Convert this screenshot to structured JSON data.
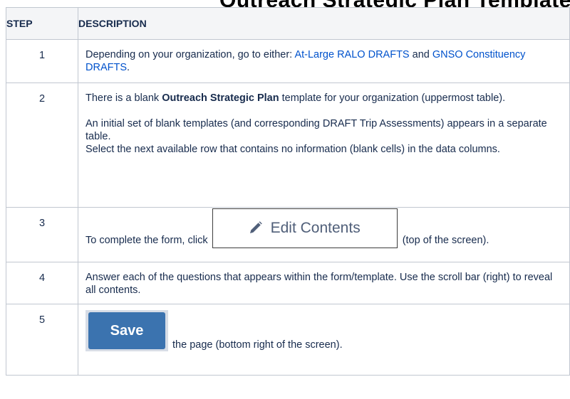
{
  "page": {
    "title_fragment": "   Outreach Strategic Plan Template"
  },
  "table": {
    "header": {
      "step": "STEP",
      "description": "DESCRIPTION"
    },
    "rows": [
      {
        "step": "1",
        "text_before": "Depending on your organization, go to either: ",
        "link1": "At-Large RALO DRAFTS",
        "text_mid": " and ",
        "link2": "GNSO Constituency DRAFTS",
        "text_after": "."
      },
      {
        "step": "2",
        "p1_before": "There is a blank ",
        "p1_bold": "Outreach Strategic Plan",
        "p1_after": " template for your organization (uppermost table).",
        "p2": "An initial set of blank templates (and corresponding DRAFT Trip Assessments) appears in a separate table.",
        "p3": "Select the next available row that contains no information (blank cells) in the data columns."
      },
      {
        "step": "3",
        "text_before": "To complete the form, click ",
        "button_label": "Edit Contents",
        "button_icon": "pencil-icon",
        "text_after": " (top of the screen)."
      },
      {
        "step": "4",
        "text": "Answer each of the questions that appears within the form/template. Use the scroll bar (right) to reveal all contents."
      },
      {
        "step": "5",
        "button_label": "Save",
        "text_after": " the page (bottom right of the screen)."
      }
    ]
  },
  "colors": {
    "link": "#0052cc",
    "save_button": "#3b73af",
    "header_bg": "#f4f5f7",
    "border": "#c1c7d0"
  }
}
